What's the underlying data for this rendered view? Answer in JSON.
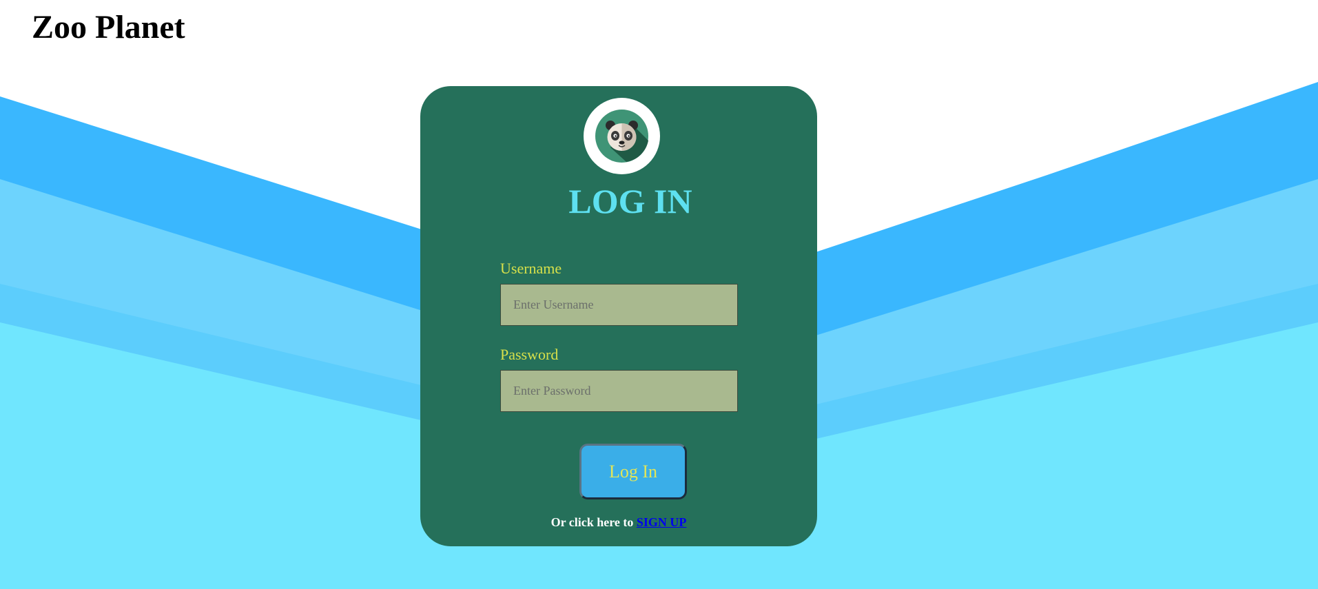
{
  "header": {
    "site_title": "Zoo Planet"
  },
  "login_card": {
    "logo_icon": "panda-icon",
    "title": "LOG IN",
    "username": {
      "label": "Username",
      "placeholder": "Enter Username",
      "value": ""
    },
    "password": {
      "label": "Password",
      "placeholder": "Enter Password",
      "value": ""
    },
    "submit_label": "Log In",
    "signup_prompt": "Or click here to ",
    "signup_link_label": "SIGN UP"
  },
  "colors": {
    "card_background": "#25705a",
    "title_color": "#5ee0f0",
    "label_color": "#d7e04a",
    "input_background": "#a9b98f",
    "button_background": "#3aaee8",
    "button_text": "#e2e658",
    "wave_dark": "#3ab7fe",
    "wave_mid": "#6dd3fd",
    "wave_light": "#70e6fe"
  }
}
